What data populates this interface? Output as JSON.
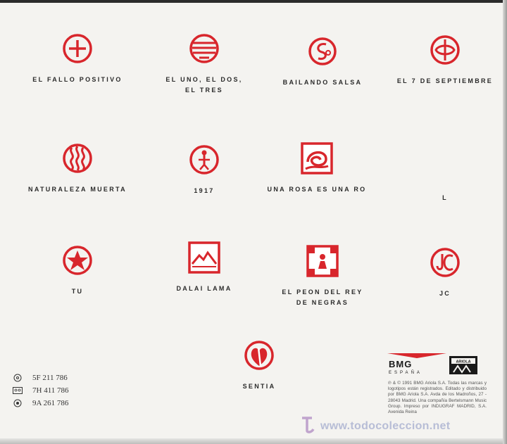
{
  "tracks": [
    {
      "title": "EL FALLO POSITIVO",
      "symbol": "cross-circle-icon"
    },
    {
      "title": "EL UNO, EL DOS, EL TRES",
      "symbol": "lined-circle-icon"
    },
    {
      "title": "BAILANDO SALSA",
      "symbol": "swirl-circle-icon"
    },
    {
      "title": "EL 7 DE SEPTIEMBRE",
      "symbol": "glyph-circle-icon"
    },
    {
      "title": "NATURALEZA MUERTA",
      "symbol": "wave-circle-icon"
    },
    {
      "title": "1917",
      "symbol": "figure-circle-icon"
    },
    {
      "title": "UNA ROSA ES UNA RO",
      "symbol": "rose-square-icon"
    },
    {
      "title": "L",
      "symbol": "none"
    },
    {
      "title": "TU",
      "symbol": "star-circle-icon"
    },
    {
      "title": "DALAI LAMA",
      "symbol": "mountain-square-icon"
    },
    {
      "title": "EL PEON DEL REY DE NEGRAS",
      "symbol": "pawn-square-icon"
    },
    {
      "title": "JC",
      "symbol": "jc-circle-icon"
    },
    {
      "title": "SENTIA",
      "symbol": "heart-circle-icon"
    }
  ],
  "catalog": [
    {
      "code": "5F 211 786",
      "icon": "cd-icon"
    },
    {
      "code": "7H 411 786",
      "icon": "cassette-icon"
    },
    {
      "code": "9A 261 786",
      "icon": "vinyl-icon"
    }
  ],
  "label": {
    "name": "BMG",
    "sub": "ESPAÑA",
    "tagline": "ARIOLA"
  },
  "legal_text": "℗ & © 1991 BMG Ariola S.A. Todas las marcas y logotipos están registrados. Editado y distribuido por BMG Ariola S.A. Avda de los Madroños, 27 - 28043 Madrid. Una compañía Bertelsmann Music Group. Impreso por INDUGRAF MADRID, S.A. Avenida Reina",
  "watermark": "www.todocoleccion.net",
  "colors": {
    "accent": "#d8262c",
    "ink": "#2a2a2a",
    "paper": "#f4f3f0"
  }
}
